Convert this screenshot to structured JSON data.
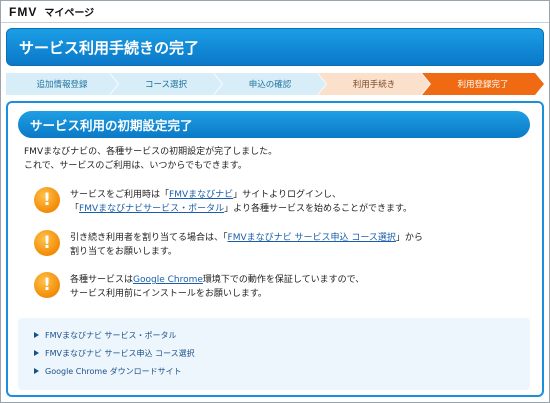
{
  "header": {
    "logo": "FMV",
    "mypage": "マイページ"
  },
  "page_title": "サービス利用手続きの完了",
  "steps": [
    "追加情報登録",
    "コース選択",
    "申込の確認",
    "利用手続き",
    "利用登録完了"
  ],
  "section": {
    "title": "サービス利用の初期設定完了",
    "intro_1": "FMVまなびナビの、各種サービスの初期設定が完了しました。",
    "intro_2": "これで、サービスのご利用は、いつからでもできます。"
  },
  "notices": [
    {
      "l1_pre": "サービスをご利用時は「",
      "l1_link": "FMVまなびナビ",
      "l1_post": "」サイトよりログインし、",
      "l2_pre": "「",
      "l2_link": "FMVまなびナビサービス・ポータル",
      "l2_post": "」より各種サービスを始めることができます。"
    },
    {
      "l1_pre": "引き続き利用者を割り当てる場合は、「",
      "l1_link": "FMVまなびナビ サービス申込 コース選択",
      "l1_post": "」から",
      "l2": "割り当てをお願いします。"
    },
    {
      "l1_pre": "各種サービスは",
      "l1_link": "Google Chrome",
      "l1_post": "環境下での動作を保証していますので、",
      "l2": "サービス利用前にインストールをお願いします。"
    }
  ],
  "links": [
    "FMVまなびナビ サービス・ポータル",
    "FMVまなびナビ サービス申込 コース選択",
    "Google Chrome ダウンロードサイト"
  ]
}
